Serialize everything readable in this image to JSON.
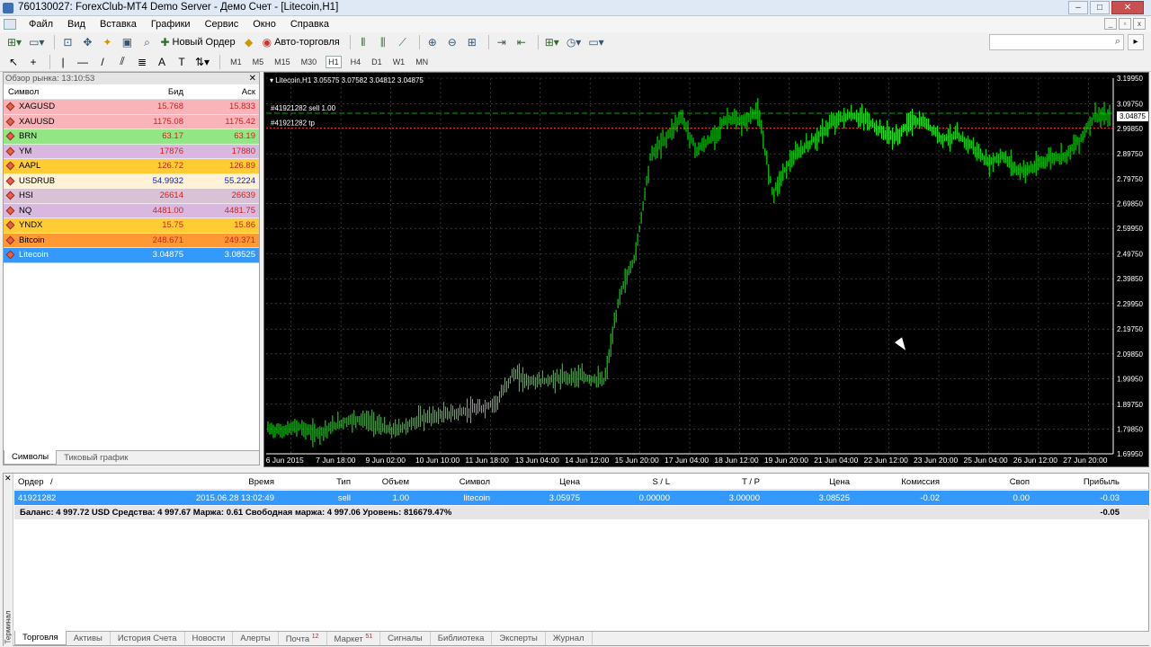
{
  "window": {
    "title": "760130027: ForexClub-MT4 Demo Server - Демо Счет - [Litecoin,H1]"
  },
  "menu": [
    "Файл",
    "Вид",
    "Вставка",
    "Графики",
    "Сервис",
    "Окно",
    "Справка"
  ],
  "toolbar": {
    "new_order": "Новый Ордер",
    "auto_trading": "Авто-торговля",
    "timeframes": [
      "M1",
      "M5",
      "M15",
      "M30",
      "H1",
      "H4",
      "D1",
      "W1",
      "MN"
    ],
    "selected_timeframe": "H1"
  },
  "market_watch": {
    "title": "Обзор рынка: 13:10:53",
    "col_symbol": "Символ",
    "col_bid": "Бид",
    "col_ask": "Аск",
    "rows": [
      {
        "symbol": "XAGUSD",
        "bid": "15.768",
        "ask": "15.833",
        "bg": "#f8b4b8"
      },
      {
        "symbol": "XAUUSD",
        "bid": "1175.08",
        "ask": "1175.42",
        "bg": "#f8b4b8"
      },
      {
        "symbol": "BRN",
        "bid": "63.17",
        "ask": "63.19",
        "bg": "#93e684"
      },
      {
        "symbol": "YM",
        "bid": "17876",
        "ask": "17880",
        "bg": "#d9b8e0"
      },
      {
        "symbol": "AAPL",
        "bid": "126.72",
        "ask": "126.89",
        "bg": "#ffcc33"
      },
      {
        "symbol": "USDRUB",
        "bid": "54.9932",
        "ask": "55.2224",
        "bg": "#fff2d6"
      },
      {
        "symbol": "HSI",
        "bid": "26614",
        "ask": "26639",
        "bg": "#d9c2d6"
      },
      {
        "symbol": "NQ",
        "bid": "4481.00",
        "ask": "4481.75",
        "bg": "#d9b8e0"
      },
      {
        "symbol": "YNDX",
        "bid": "15.75",
        "ask": "15.86",
        "bg": "#ffcc33"
      },
      {
        "symbol": "Bitcoin",
        "bid": "248.671",
        "ask": "249.371",
        "bg": "#ff9933"
      },
      {
        "symbol": "Litecoin",
        "bid": "3.04875",
        "ask": "3.08525",
        "bg": "#3399ff"
      }
    ],
    "tabs": [
      "Символы",
      "Тиковый график"
    ]
  },
  "chart": {
    "header": "Litecoin,H1  3.05575 3.07582 3.04812 3.04875",
    "order_line": "#41921282 sell 1.00",
    "tp_line": "#41921282 tp",
    "current_price": "3.04875"
  },
  "chart_data": {
    "type": "bar",
    "title": "Litecoin,H1",
    "x_ticks": [
      "6 Jun 2015",
      "7 Jun 18:00",
      "9 Jun 02:00",
      "10 Jun 10:00",
      "11 Jun 18:00",
      "13 Jun 04:00",
      "14 Jun 12:00",
      "15 Jun 20:00",
      "17 Jun 04:00",
      "18 Jun 12:00",
      "19 Jun 20:00",
      "21 Jun 04:00",
      "22 Jun 12:00",
      "23 Jun 20:00",
      "25 Jun 04:00",
      "26 Jun 12:00",
      "27 Jun 20:00"
    ],
    "y_ticks": [
      "3.19950",
      "3.09750",
      "2.99850",
      "2.89750",
      "2.79750",
      "2.69850",
      "2.59950",
      "2.49750",
      "2.39850",
      "2.29950",
      "2.19750",
      "2.09850",
      "1.99950",
      "1.89750",
      "1.79850",
      "1.69950"
    ],
    "ylim": [
      1.6995,
      3.1995
    ],
    "series": [
      {
        "values": [
          1.8,
          1.79,
          1.81,
          1.78,
          1.8,
          1.83,
          1.84,
          1.82,
          1.79,
          1.81,
          1.84,
          1.85,
          1.86,
          1.87,
          1.88,
          1.91,
          2.02,
          1.99,
          1.99,
          2.0,
          2.01,
          2.0,
          1.99,
          2.34,
          2.49,
          2.89,
          2.96,
          3.05,
          2.91,
          2.96,
          3.04,
          3.02,
          3.07,
          2.74,
          2.86,
          2.92,
          2.97,
          3.03,
          3.05,
          3.04,
          2.99,
          2.96,
          3.03,
          3.02,
          2.96,
          2.97,
          2.93,
          2.86,
          2.89,
          2.83,
          2.84,
          2.88,
          2.89,
          2.95,
          3.05,
          3.04
        ]
      }
    ]
  },
  "terminal": {
    "side_label": "Терминал",
    "headers": [
      "Ордер",
      "/",
      "Время",
      "Тип",
      "Объем",
      "Символ",
      "Цена",
      "S / L",
      "T / P",
      "Цена",
      "Комиссия",
      "Своп",
      "Прибыль"
    ],
    "order": {
      "id": "41921282",
      "time": "2015.06.28 13:02:49",
      "type": "sell",
      "volume": "1.00",
      "symbol": "litecoin",
      "price": "3.05975",
      "sl": "0.00000",
      "tp": "3.00000",
      "cur_price": "3.08525",
      "commission": "-0.02",
      "swap": "0.00",
      "profit": "-0.03"
    },
    "balance": "Баланс: 4 997.72 USD  Средства: 4 997.67  Маржа: 0.61  Свободная маржа: 4 997.06  Уровень: 816679.47%",
    "total_profit": "-0.05",
    "tabs": [
      {
        "label": "Торговля",
        "badge": ""
      },
      {
        "label": "Активы",
        "badge": ""
      },
      {
        "label": "История Счета",
        "badge": ""
      },
      {
        "label": "Новости",
        "badge": ""
      },
      {
        "label": "Алерты",
        "badge": ""
      },
      {
        "label": "Почта",
        "badge": "12"
      },
      {
        "label": "Маркет",
        "badge": "51"
      },
      {
        "label": "Сигналы",
        "badge": ""
      },
      {
        "label": "Библиотека",
        "badge": ""
      },
      {
        "label": "Эксперты",
        "badge": ""
      },
      {
        "label": "Журнал",
        "badge": ""
      }
    ]
  },
  "colors": {
    "chart_bg": "#000000",
    "candles": "#00ff00",
    "grid": "#555555",
    "tp_line": "#ff3333",
    "order_line": "#00aa00"
  }
}
